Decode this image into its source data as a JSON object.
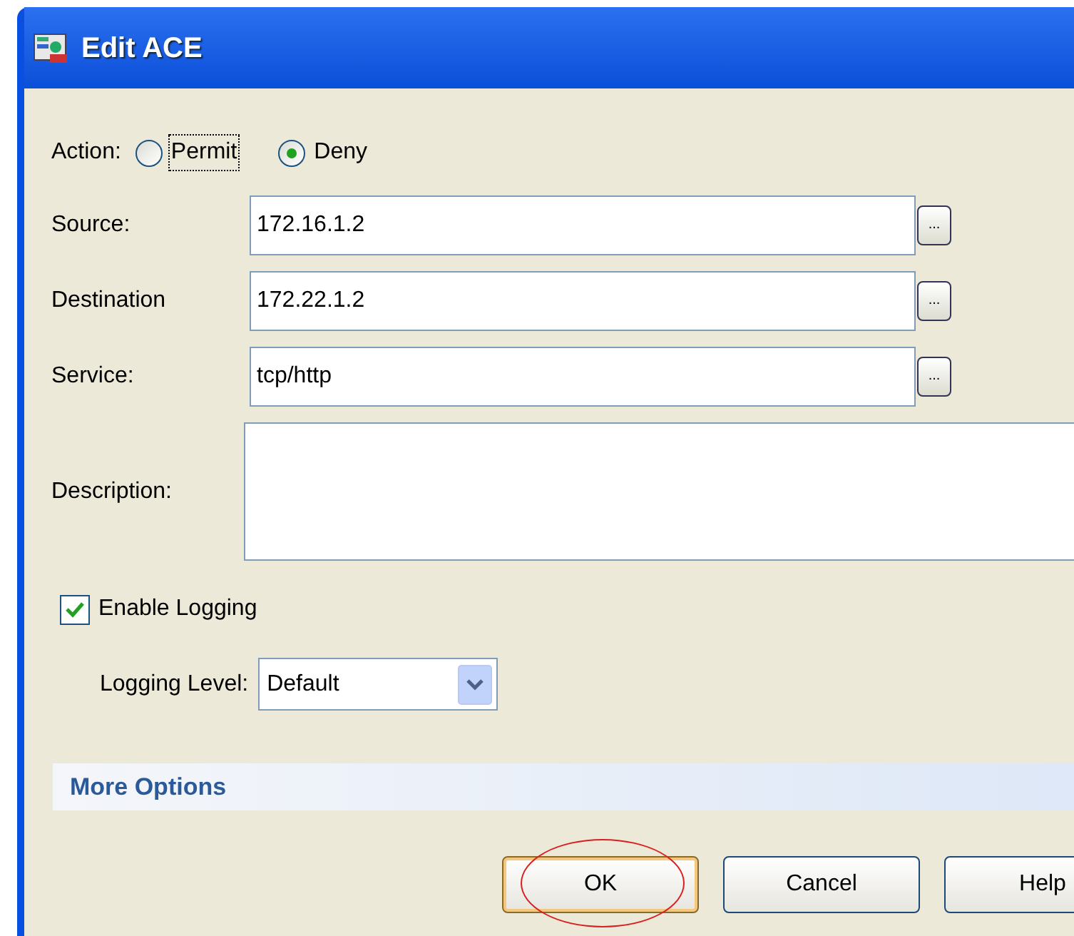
{
  "window": {
    "title": "Edit ACE"
  },
  "action": {
    "label": "Action:",
    "options": [
      {
        "label": "Permit",
        "selected": false,
        "focused": true
      },
      {
        "label": "Deny",
        "selected": true,
        "focused": false
      }
    ]
  },
  "fields": [
    {
      "label": "Source:",
      "value": "172.16.1.2",
      "kind": "browse"
    },
    {
      "label": "Destination",
      "value": "172.22.1.2",
      "kind": "browse"
    },
    {
      "label": "Service:",
      "value": "tcp/http",
      "kind": "browse"
    },
    {
      "label": "Description:",
      "kind": "multiline"
    }
  ],
  "browse_button": "...",
  "enable_logging": {
    "label": "Enable Logging",
    "checked": true
  },
  "logging_level": {
    "label": "Logging Level:",
    "value": "Default"
  },
  "more_options": "More Options",
  "buttons": [
    {
      "label": "OK",
      "highlighted": true
    },
    {
      "label": "Cancel",
      "highlighted": false
    },
    {
      "label": "Help",
      "highlighted": false
    }
  ]
}
